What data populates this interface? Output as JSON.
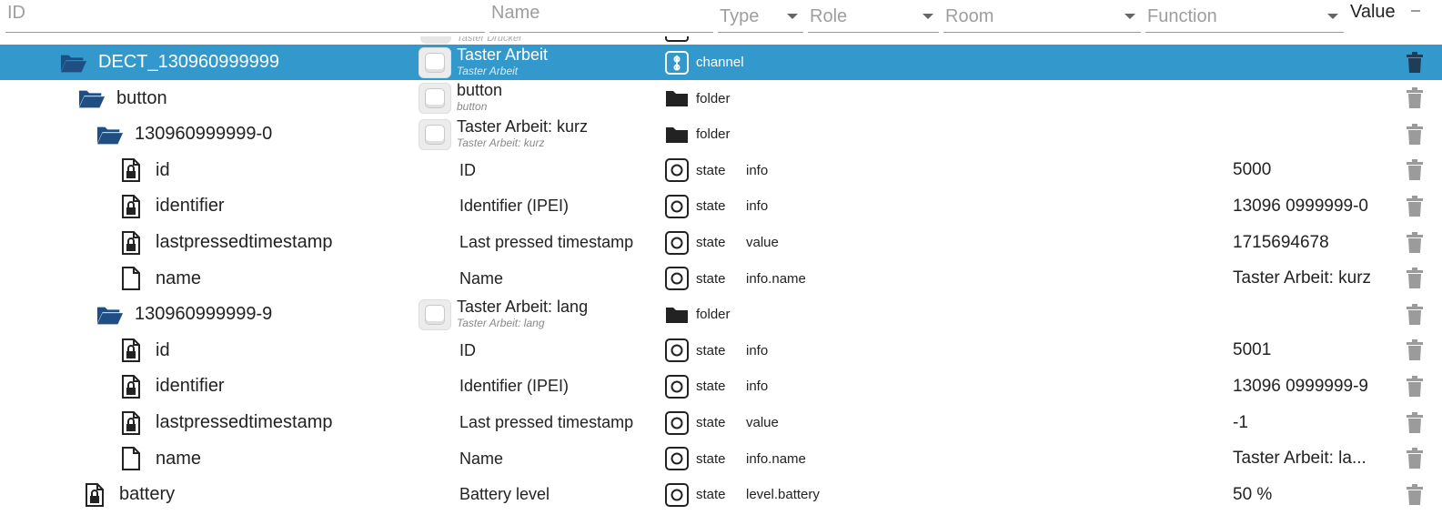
{
  "header": {
    "id_placeholder": "ID",
    "name_placeholder": "Name",
    "type_label": "Type",
    "role_label": "Role",
    "room_label": "Room",
    "function_label": "Function",
    "value_label": "Value"
  },
  "partial_row": {
    "name_sub": "Taster Drücker"
  },
  "rows": [
    {
      "id": "DECT_130960999999",
      "id_icon": "folder-open-icon",
      "name": "Taster Arbeit",
      "name_sub": "Taster Arbeit",
      "type": "channel",
      "type_icon": "channel-icon",
      "role": "",
      "value": ""
    },
    {
      "id": "button",
      "id_icon": "folder-open-icon",
      "name": "button",
      "name_sub": "button",
      "type": "folder",
      "type_icon": "folder-icon",
      "role": "",
      "value": ""
    },
    {
      "id": "130960999999-0",
      "id_icon": "folder-open-icon",
      "name": "Taster Arbeit: kurz",
      "name_sub": "Taster Arbeit: kurz",
      "type": "folder",
      "type_icon": "folder-icon",
      "role": "",
      "value": ""
    },
    {
      "id": "id",
      "id_icon": "file-lock-icon",
      "name": "ID",
      "name_sub": "",
      "type": "state",
      "type_icon": "state-icon",
      "role": "info",
      "value": "5000"
    },
    {
      "id": "identifier",
      "id_icon": "file-lock-icon",
      "name": "Identifier (IPEI)",
      "name_sub": "",
      "type": "state",
      "type_icon": "state-icon",
      "role": "info",
      "value": "13096 0999999-0"
    },
    {
      "id": "lastpressedtimestamp",
      "id_icon": "file-lock-icon",
      "name": "Last pressed timestamp",
      "name_sub": "",
      "type": "state",
      "type_icon": "state-icon",
      "role": "value",
      "value": "1715694678"
    },
    {
      "id": "name",
      "id_icon": "file-icon",
      "name": "Name",
      "name_sub": "",
      "type": "state",
      "type_icon": "state-icon",
      "role": "info.name",
      "value": "Taster Arbeit: kurz"
    },
    {
      "id": "130960999999-9",
      "id_icon": "folder-open-icon",
      "name": "Taster Arbeit: lang",
      "name_sub": "Taster Arbeit: lang",
      "type": "folder",
      "type_icon": "folder-icon",
      "role": "",
      "value": ""
    },
    {
      "id": "id",
      "id_icon": "file-lock-icon",
      "name": "ID",
      "name_sub": "",
      "type": "state",
      "type_icon": "state-icon",
      "role": "info",
      "value": "5001"
    },
    {
      "id": "identifier",
      "id_icon": "file-lock-icon",
      "name": "Identifier (IPEI)",
      "name_sub": "",
      "type": "state",
      "type_icon": "state-icon",
      "role": "info",
      "value": "13096 0999999-9"
    },
    {
      "id": "lastpressedtimestamp",
      "id_icon": "file-lock-icon",
      "name": "Last pressed timestamp",
      "name_sub": "",
      "type": "state",
      "type_icon": "state-icon",
      "role": "value",
      "value": "-1"
    },
    {
      "id": "name",
      "id_icon": "file-icon",
      "name": "Name",
      "name_sub": "",
      "type": "state",
      "type_icon": "state-icon",
      "role": "info.name",
      "value": "Taster Arbeit: la..."
    },
    {
      "id": "battery",
      "id_icon": "file-lock-icon",
      "name": "Battery level",
      "name_sub": "",
      "type": "state",
      "type_icon": "state-icon",
      "role": "level.battery",
      "value": "50 %"
    }
  ],
  "colors": {
    "selected_row": "#3399cc",
    "folder_icon": "#1f4f82",
    "trash_icon": "#9b9b9b",
    "header_placeholder": "#9e9e9e"
  }
}
